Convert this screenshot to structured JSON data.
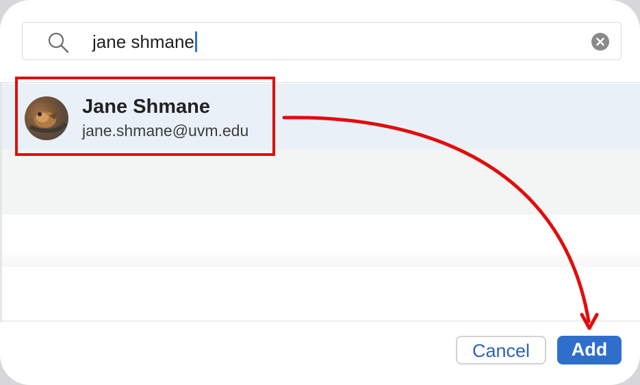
{
  "search": {
    "value": "jane shmane"
  },
  "results": [
    {
      "name": "Jane Shmane",
      "email": "jane.shmane@uvm.edu",
      "selected": true
    }
  ],
  "buttons": {
    "cancel_label": "Cancel",
    "add_label": "Add"
  },
  "icons": {
    "search": "search-icon",
    "clear": "clear-icon",
    "avatar": "avatar"
  },
  "colors": {
    "accent": "#2f6fcb",
    "annotation": "#e10d0d",
    "selected_row": "#eaf0f8"
  }
}
